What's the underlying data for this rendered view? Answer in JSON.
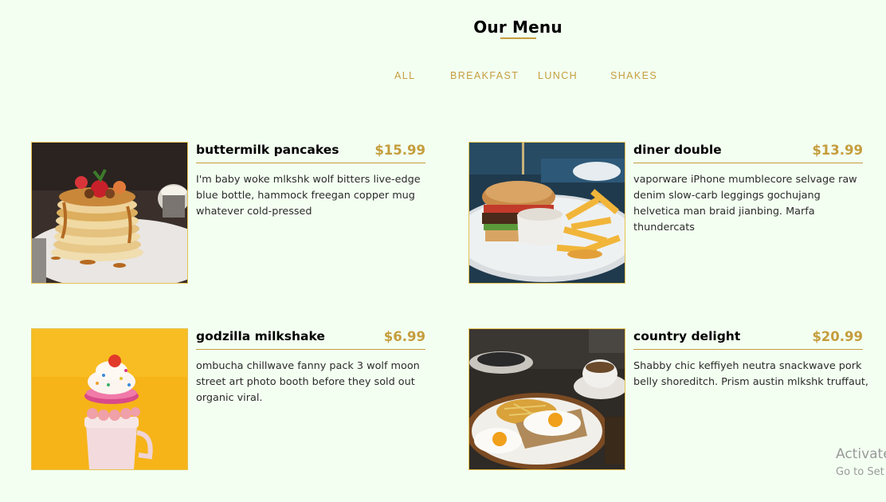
{
  "page": {
    "title": "Our Menu"
  },
  "filters": [
    {
      "label": "ALL"
    },
    {
      "label": "BREAKFAST"
    },
    {
      "label": "LUNCH"
    },
    {
      "label": "SHAKES"
    }
  ],
  "menu": [
    {
      "name": "buttermilk pancakes",
      "price": "$15.99",
      "desc_lines": [
        "I'm baby woke mlkshk wolf bitters live-edge",
        "blue bottle, hammock freegan copper mug",
        "whatever cold-pressed"
      ]
    },
    {
      "name": "diner double",
      "price": "$13.99",
      "desc_lines": [
        "vaporware iPhone mumblecore selvage raw",
        "denim slow-carb leggings gochujang",
        "helvetica man braid jianbing. Marfa",
        "thundercats"
      ]
    },
    {
      "name": "godzilla milkshake",
      "price": "$6.99",
      "desc_lines": [
        "ombucha chillwave fanny pack 3 wolf moon",
        "street art photo booth before they sold out",
        "organic viral."
      ]
    },
    {
      "name": "country delight",
      "price": "$20.99",
      "desc_lines": [
        "Shabby chic keffiyeh neutra snackwave pork",
        "belly shoreditch. Prism austin mlkshk truffaut,"
      ]
    }
  ],
  "watermark": {
    "line1": "Activate",
    "line2": "Go to Set"
  },
  "colors": {
    "background": "#f3fff1",
    "accent": "#c59d3d",
    "image_border": "#e5c24f"
  }
}
